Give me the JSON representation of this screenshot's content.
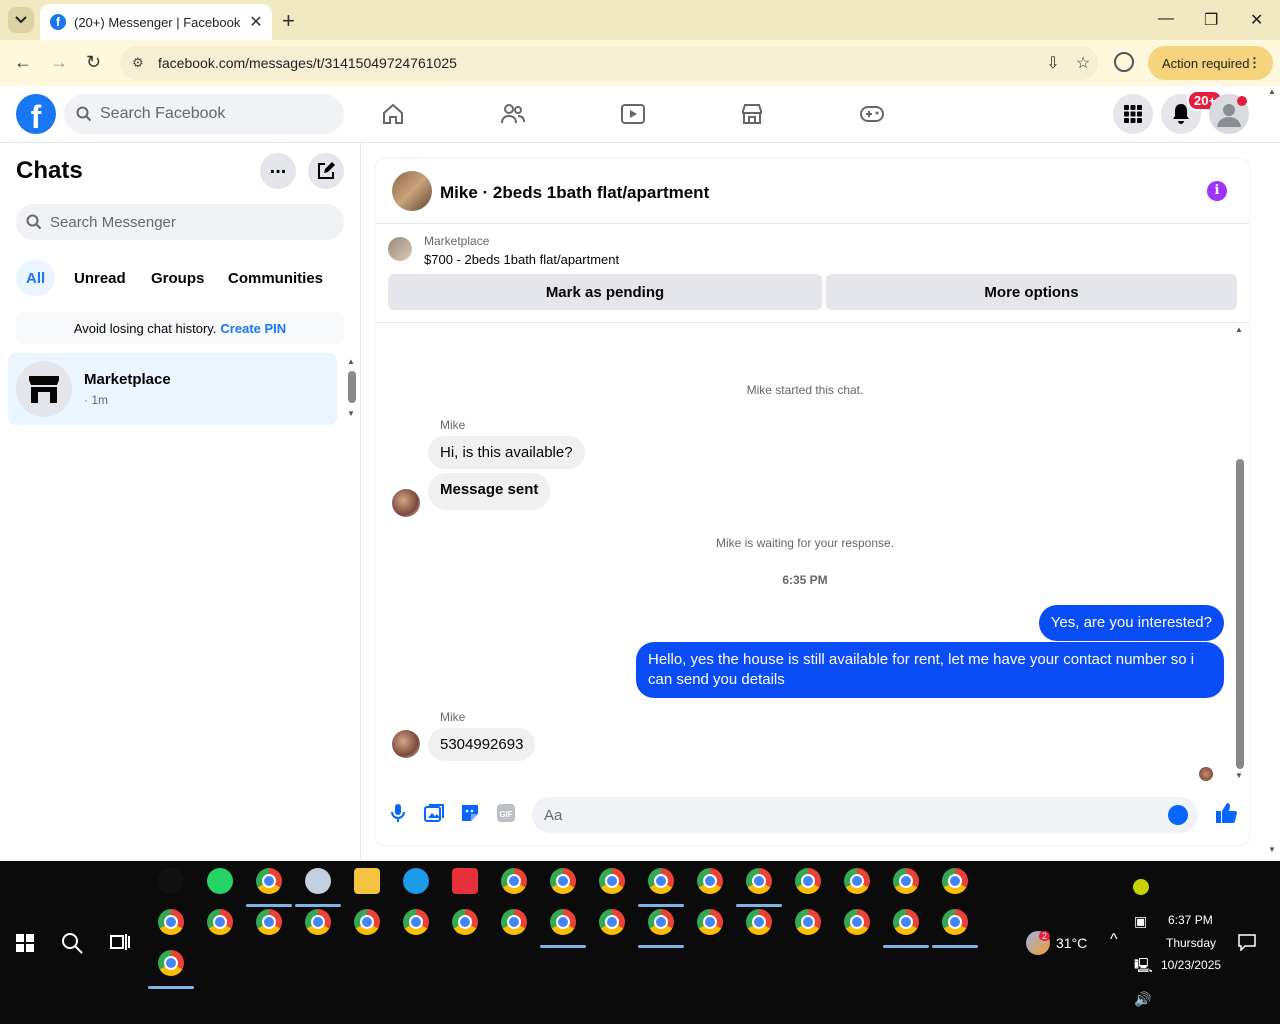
{
  "browser": {
    "tab_title": "(20+) Messenger | Facebook",
    "url": "facebook.com/messages/t/31415049724761025",
    "action_required": "Action required"
  },
  "facebook": {
    "search_placeholder": "Search Facebook",
    "notification_badge": "20+"
  },
  "sidebar": {
    "title": "Chats",
    "search_placeholder": "Search Messenger",
    "filters": [
      "All",
      "Unread",
      "Groups",
      "Communities"
    ],
    "pin_notice": "Avoid losing chat history.",
    "pin_link": "Create PIN",
    "chat_item": {
      "name": "Marketplace",
      "time": "· 1m"
    }
  },
  "conversation": {
    "title": "Mike · 2beds 1bath flat/apartment",
    "marketplace_label": "Marketplace",
    "listing": "$700 - 2beds 1bath flat/apartment",
    "btn_pending": "Mark as pending",
    "btn_more": "More options",
    "started": "Mike started this chat.",
    "sender1": "Mike",
    "msg1": "Hi, is this available?",
    "msg2": "Message sent",
    "waiting": "Mike is waiting for your response.",
    "timestamp": "6:35 PM",
    "out1": "Yes, are you interested?",
    "out2": "Hello, yes the house is still available for rent, let me have your contact number so i can send you details",
    "sender2": "Mike",
    "msg3": "5304992693",
    "composer_placeholder": "Aa"
  },
  "taskbar": {
    "temperature": "31°C",
    "time": "6:37 PM",
    "day": "Thursday",
    "date": "10/23/2025",
    "weather_badge": "2"
  },
  "colors": {
    "fb_blue": "#1877f2",
    "out_bubble": "#0a4cf5",
    "info": "#a033ff"
  }
}
